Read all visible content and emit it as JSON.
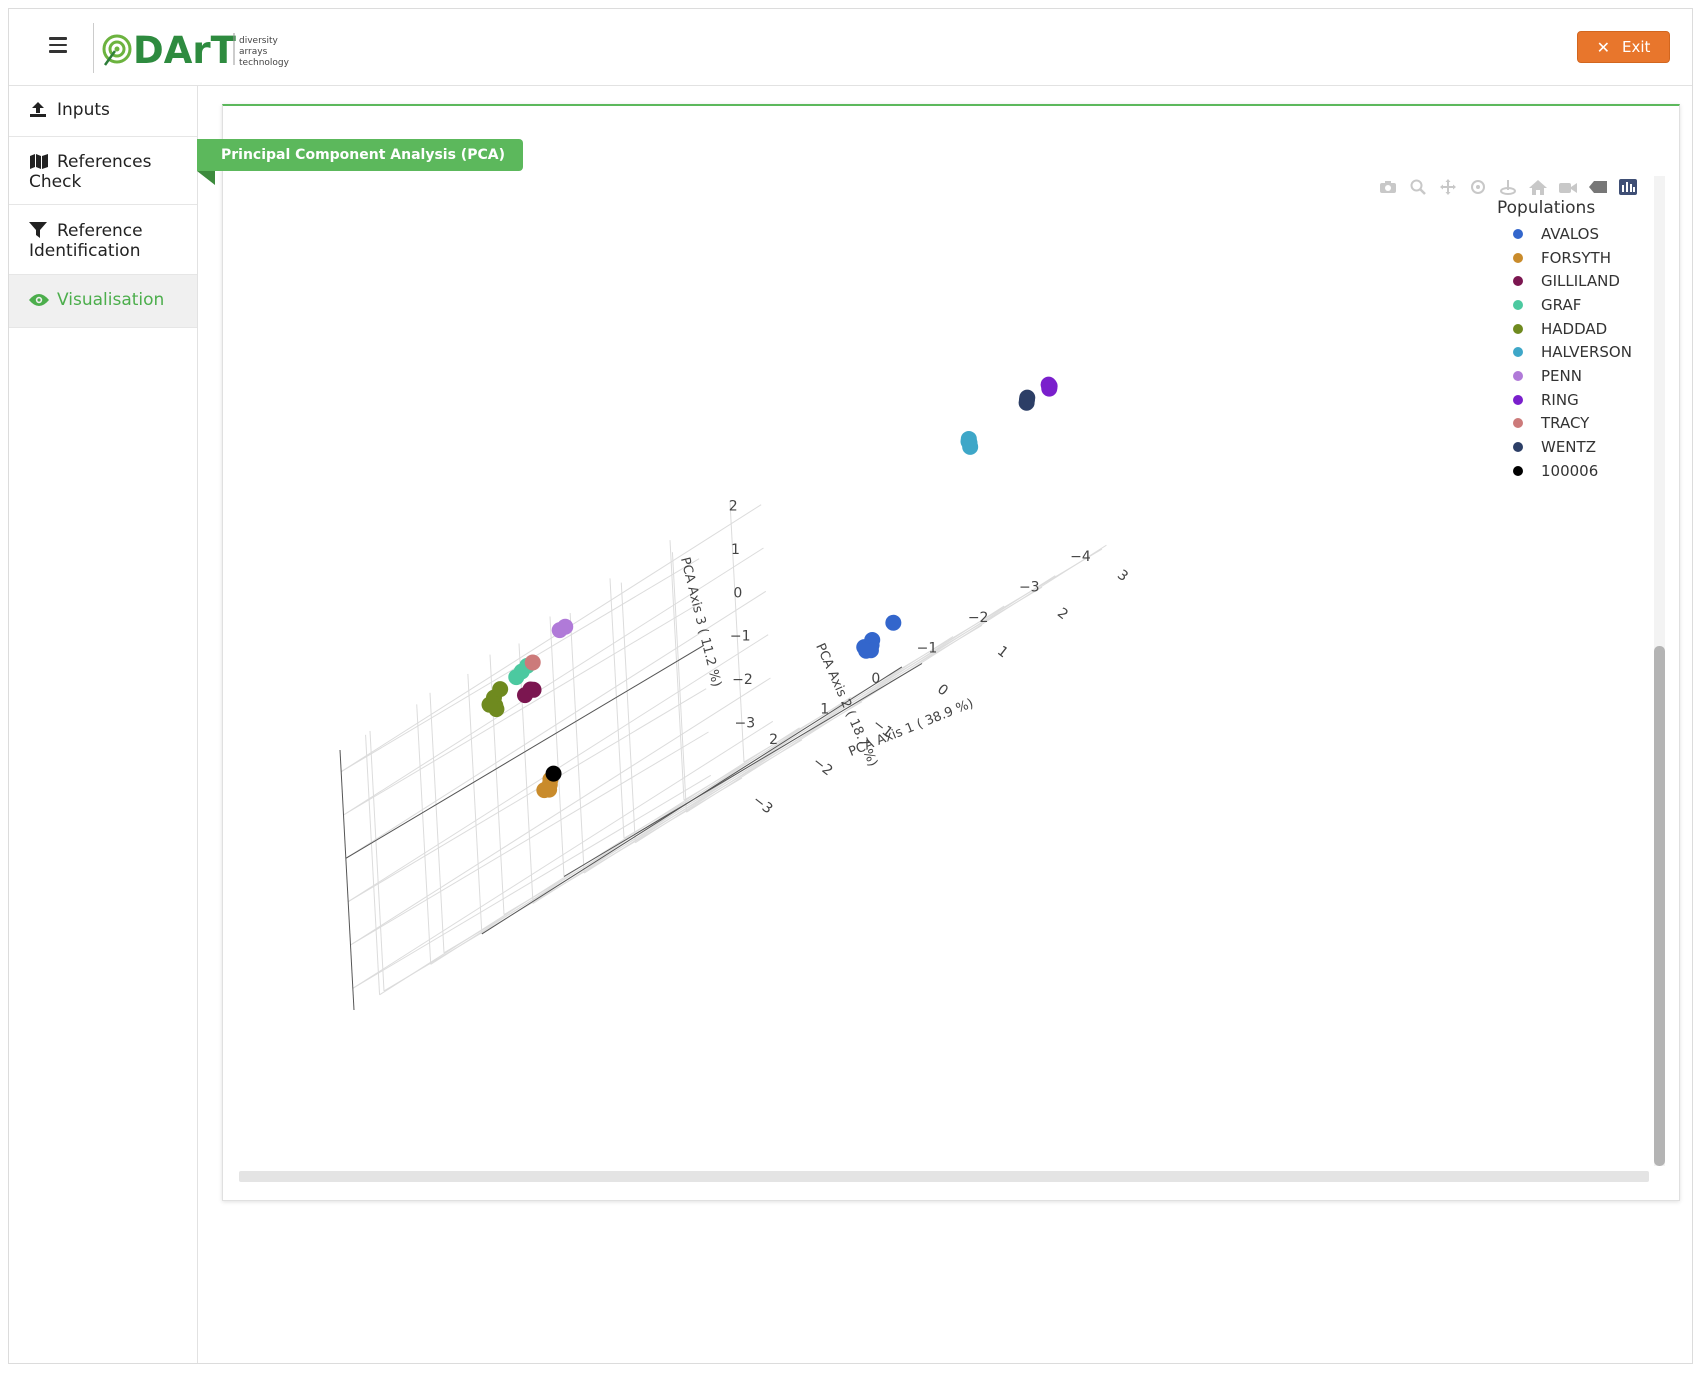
{
  "header": {
    "logo_text": "DArT",
    "logo_tagline": [
      "diversity",
      "arrays",
      "technology"
    ],
    "exit_label": "Exit",
    "exit_color": "#e8762c"
  },
  "sidebar": {
    "items": [
      {
        "label": "Inputs",
        "icon": "upload-icon"
      },
      {
        "label": "References Check",
        "icon": "map-icon"
      },
      {
        "label": "Reference Identification",
        "icon": "filter-icon"
      },
      {
        "label": "Visualisation",
        "icon": "eye-icon",
        "active": true
      }
    ]
  },
  "panel": {
    "title": "Principal Component Analysis (PCA)",
    "accent": "#5cb85c"
  },
  "modebar": {
    "icons": [
      "camera-icon",
      "zoom-icon",
      "pan-icon",
      "orbit-icon",
      "turntable-icon",
      "reset-camera-icon",
      "save-view-icon",
      "hover-icon",
      "plotly-logo-icon"
    ]
  },
  "chart_data": {
    "type": "scatter",
    "dimension": "3d",
    "axes": {
      "x": {
        "label": "PCA Axis 1 ( 38.9 %)",
        "ticks": [
          3,
          2,
          1,
          0,
          -1,
          -2,
          -3
        ]
      },
      "y": {
        "label": "PCA Axis 2 ( 18.7 %)",
        "ticks": [
          2,
          1,
          0,
          -1,
          -2,
          -3,
          -4
        ]
      },
      "z": {
        "label": "PCA Axis 3 ( 11.2 %)",
        "ticks": [
          2,
          1,
          0,
          -1,
          -2,
          -3
        ]
      }
    },
    "legend": {
      "title": "Populations",
      "placement": "top-right"
    },
    "grid": true,
    "series": [
      {
        "name": "AVALOS",
        "color": "#3366cc",
        "points": [
          [
            1.5,
            -1.8,
            -2.5
          ],
          [
            1.6,
            -1.7,
            -2.4
          ],
          [
            1.4,
            -1.9,
            -2.6
          ],
          [
            1.55,
            -1.6,
            -2.45
          ],
          [
            1.45,
            -1.75,
            -2.55
          ],
          [
            1.7,
            -2.0,
            -2.3
          ]
        ]
      },
      {
        "name": "FORSYTH",
        "color": "#c98b2b",
        "points": [
          [
            -1.0,
            1.5,
            -1.2
          ],
          [
            -1.1,
            1.4,
            -1.3
          ],
          [
            -0.9,
            1.6,
            -1.1
          ],
          [
            -1.05,
            1.55,
            -1.25
          ]
        ]
      },
      {
        "name": "GILLILAND",
        "color": "#7b1650",
        "points": [
          [
            -2.2,
            0.3,
            1.2
          ],
          [
            -2.3,
            0.35,
            1.2
          ],
          [
            -2.25,
            0.3,
            1.25
          ]
        ]
      },
      {
        "name": "GRAF",
        "color": "#4cc9a0",
        "points": [
          [
            -2.8,
            -0.2,
            1.8
          ],
          [
            -2.85,
            -0.15,
            1.75
          ],
          [
            -2.75,
            -0.25,
            1.85
          ]
        ]
      },
      {
        "name": "HADDAD",
        "color": "#6f8a1f",
        "points": [
          [
            -3.0,
            0.1,
            1.4
          ],
          [
            -3.1,
            0.0,
            1.6
          ],
          [
            -2.9,
            0.2,
            1.3
          ],
          [
            -3.05,
            0.15,
            1.5
          ],
          [
            -2.95,
            0.05,
            1.7
          ]
        ]
      },
      {
        "name": "HALVERSON",
        "color": "#3ea7c8",
        "points": [
          [
            1.8,
            -3.5,
            0.8
          ],
          [
            1.85,
            -3.45,
            0.7
          ],
          [
            1.75,
            -3.55,
            0.75
          ],
          [
            1.9,
            -3.4,
            0.6
          ]
        ]
      },
      {
        "name": "PENN",
        "color": "#b07ad8",
        "points": [
          [
            -2.4,
            -0.6,
            2.2
          ],
          [
            -2.45,
            -0.55,
            2.2
          ]
        ]
      },
      {
        "name": "RING",
        "color": "#7a1fcc",
        "points": [
          [
            2.8,
            -3.9,
            0.8
          ],
          [
            2.85,
            -3.85,
            0.85
          ],
          [
            2.75,
            -3.95,
            0.9
          ]
        ]
      },
      {
        "name": "TRACY",
        "color": "#cc7a7a",
        "points": [
          [
            -2.7,
            -0.3,
            1.85
          ]
        ]
      },
      {
        "name": "WENTZ",
        "color": "#2c3e66",
        "points": [
          [
            2.6,
            -3.7,
            0.85
          ],
          [
            2.55,
            -3.75,
            0.8
          ],
          [
            2.65,
            -3.65,
            0.9
          ]
        ]
      },
      {
        "name": "100006",
        "color": "#000000",
        "points": [
          [
            -1.1,
            1.3,
            -1.0
          ]
        ]
      }
    ]
  }
}
